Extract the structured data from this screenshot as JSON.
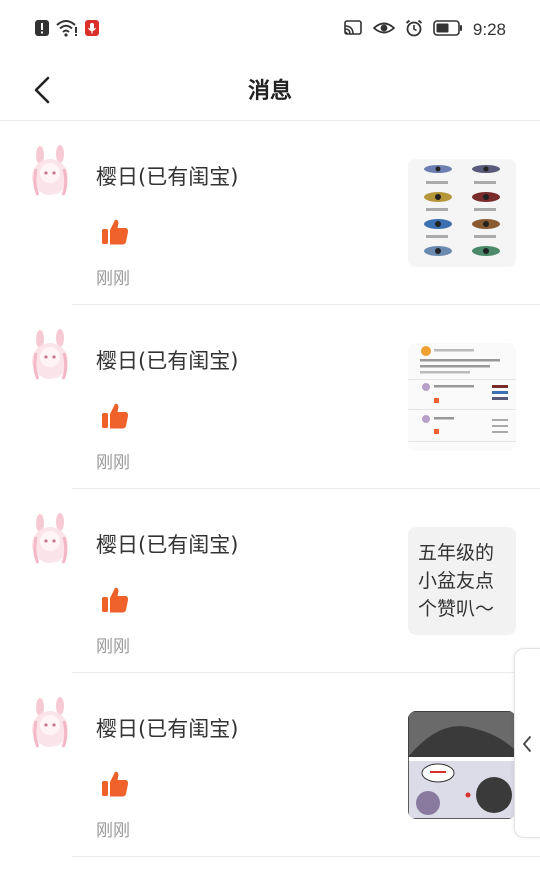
{
  "status_bar": {
    "time": "9:28",
    "left_icons": [
      "alert-icon",
      "wifi-warning-icon",
      "mic-icon"
    ],
    "right_icons": [
      "cast-icon",
      "eye-icon",
      "alarm-icon",
      "battery-icon"
    ]
  },
  "header": {
    "title": "消息",
    "back_icon": "back-arrow-icon"
  },
  "messages": [
    {
      "user": "樱日(已有闺宝)",
      "action_icon": "thumbs-up-icon",
      "time": "刚刚",
      "preview_type": "image"
    },
    {
      "user": "樱日(已有闺宝)",
      "action_icon": "thumbs-up-icon",
      "time": "刚刚",
      "preview_type": "image"
    },
    {
      "user": "樱日(已有闺宝)",
      "action_icon": "thumbs-up-icon",
      "time": "刚刚",
      "preview_type": "text",
      "preview_text": "五年级的小盆友点个赞叭～"
    },
    {
      "user": "樱日(已有闺宝)",
      "action_icon": "thumbs-up-icon",
      "time": "刚刚",
      "preview_type": "image"
    }
  ],
  "colors": {
    "accent": "#f0622b",
    "time_text": "#999999",
    "separator": "#ececec"
  }
}
